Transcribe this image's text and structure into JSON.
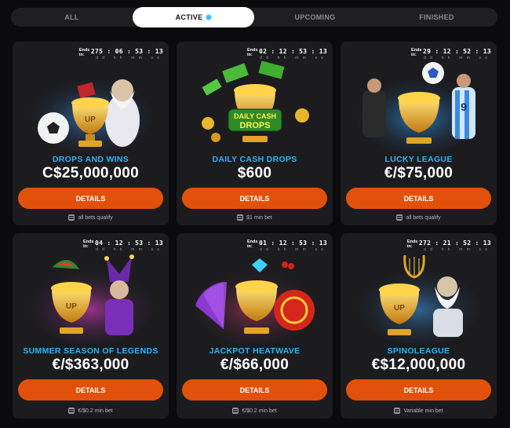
{
  "tabs": [
    {
      "label": "ALL",
      "active": false
    },
    {
      "label": "ACTIVE",
      "active": true
    },
    {
      "label": "UPCOMING",
      "active": false
    },
    {
      "label": "FINISHED",
      "active": false
    }
  ],
  "timer_units": "dd hh mm ss",
  "ends_label": "Ends in:",
  "button_label": "DETAILS",
  "cards": [
    {
      "name": "DROPS AND WINS",
      "amount": "C$25,000,000",
      "timer": "275 : 06 : 53 : 13",
      "footer": "all bets qualify",
      "art": "zeus-soccer-trophy"
    },
    {
      "name": "DAILY CASH DROPS",
      "amount": "$600",
      "timer": "02 : 12 : 53 : 13",
      "footer": "$1 min bet",
      "art": "daily-cash-drops-trophy",
      "art_text": [
        "DAILY CASH",
        "DROPS"
      ]
    },
    {
      "name": "LUCKY LEAGUE",
      "amount": "€/$75,000",
      "timer": "29 : 12 : 52 : 13",
      "footer": "all bets qualify",
      "art": "soccer-players-trophy"
    },
    {
      "name": "SUMMER SEASON OF LEGENDS",
      "amount": "€/$363,000",
      "timer": "04 : 12 : 53 : 13",
      "footer": "€/$0.2 min bet",
      "art": "jester-watermelon-trophy"
    },
    {
      "name": "JACKPOT HEATWAVE",
      "amount": "€/$66,000",
      "timer": "01 : 12 : 53 : 13",
      "footer": "€/$0.2 min bet",
      "art": "fan-gem-trophy"
    },
    {
      "name": "SPINOLEAGUE",
      "amount": "€$12,000,000",
      "timer": "272 : 21 : 52 : 13",
      "footer": "Variable min bet",
      "art": "zeus-lyre-trophy"
    }
  ],
  "colors": {
    "accent_button": "#e2510b",
    "title_blue": "#2fb4f2",
    "card_bg": "#1c1c1f",
    "page_bg": "#0b0b0d"
  }
}
